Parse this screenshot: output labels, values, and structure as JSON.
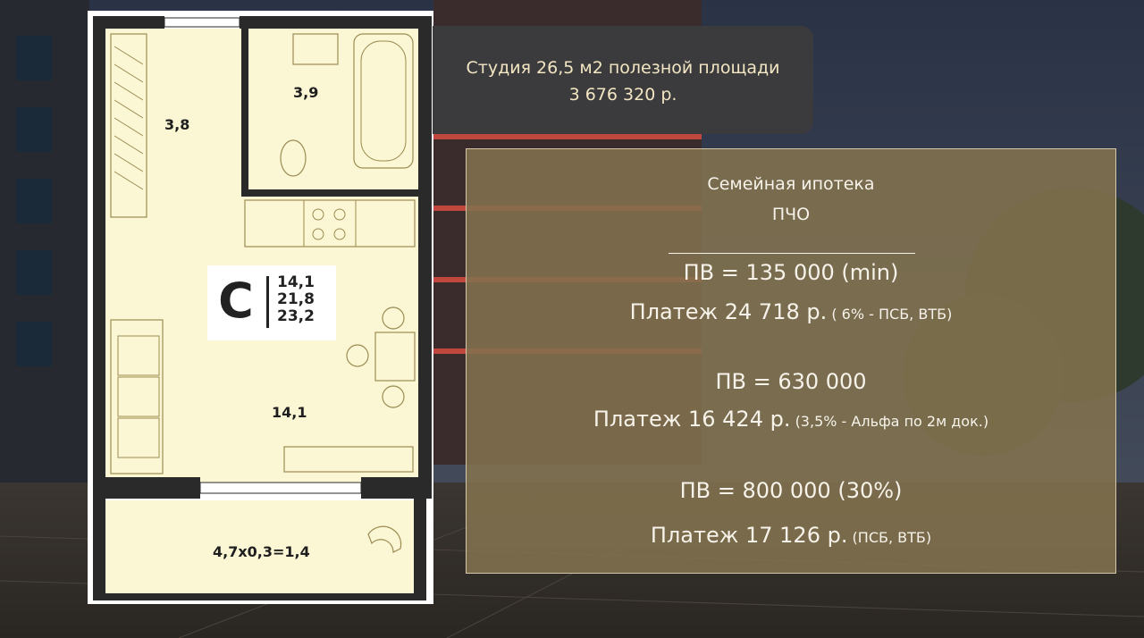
{
  "plan": {
    "rooms": {
      "hall": "3,8",
      "bath": "3,9",
      "living": "14,1",
      "balcony": "4,7x0,3=1,4"
    },
    "badge": {
      "letter": "С",
      "values": [
        "14,1",
        "21,8",
        "23,2"
      ]
    }
  },
  "header": {
    "title": "Студия 26,5 м2 полезной площади",
    "price": "3 676 320 р."
  },
  "mortgage": {
    "heading": "Семейная ипотека",
    "subheading": "ПЧО",
    "options": [
      {
        "down": "ПВ = 135 000 (min)",
        "payment": "Платеж 24 718 р.",
        "note": "( 6% - ПСБ, ВТБ)"
      },
      {
        "down": "ПВ = 630 000",
        "payment": "Платеж 16 424 р.",
        "note": "(3,5% - Альфа по 2м док.)"
      },
      {
        "down": "ПВ = 800 000 (30%)",
        "payment": "Платеж 17 126 р.",
        "note": "(ПСБ, ВТБ)"
      }
    ]
  },
  "colors": {
    "floor": "#fbf6d4",
    "wall": "#2a2a2a",
    "title_bg": "#3b3b3d",
    "title_text": "#f3e6c2",
    "mortgage_bg": "#82724e"
  }
}
